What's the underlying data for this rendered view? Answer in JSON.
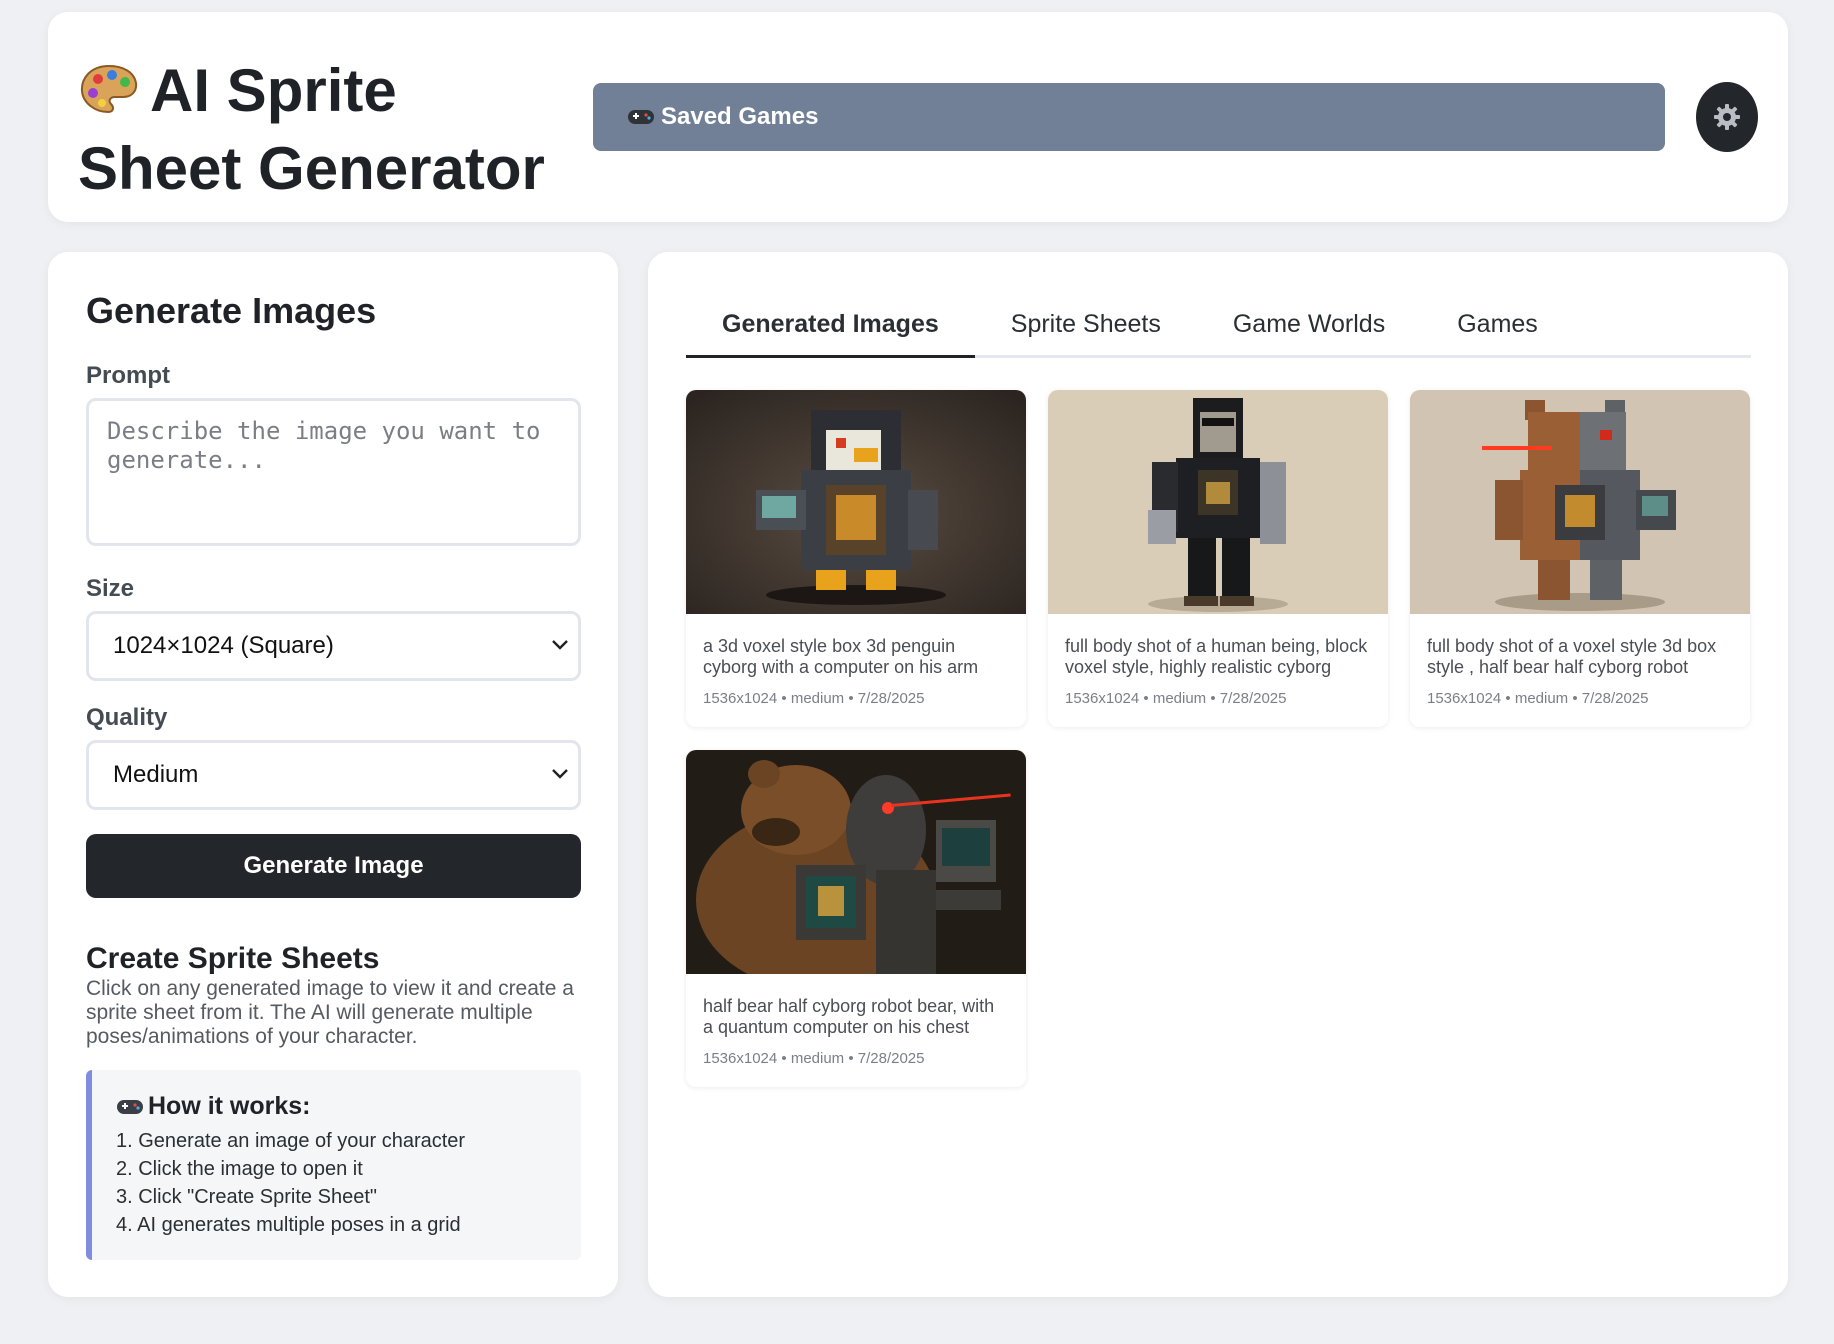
{
  "header": {
    "title": "AI Sprite Sheet Generator",
    "saved_games_label": "Saved Games",
    "palette_icon": "palette-icon",
    "settings_icon": "gear-icon"
  },
  "generate": {
    "title": "Generate Images",
    "prompt_label": "Prompt",
    "prompt_placeholder": "Describe the image you want to generate...",
    "prompt_value": "",
    "size_label": "Size",
    "size_value": "1024×1024 (Square)",
    "quality_label": "Quality",
    "quality_value": "Medium",
    "button_label": "Generate Image"
  },
  "sprite_info": {
    "title": "Create Sprite Sheets",
    "description": "Click on any generated image to view it and create a sprite sheet from it. The AI will generate multiple poses/animations of your character.",
    "how_title": "How it works:",
    "steps": [
      "1. Generate an image of your character",
      "2. Click the image to open it",
      "3. Click \"Create Sprite Sheet\"",
      "4. AI generates multiple poses in a grid"
    ]
  },
  "tabs": [
    "Generated Images",
    "Sprite Sheets",
    "Game Worlds",
    "Games"
  ],
  "active_tab": "Generated Images",
  "images": [
    {
      "caption": "a 3d voxel style box 3d penguin cyborg with a computer on his arm",
      "size": "1536x1024",
      "quality": "medium",
      "date": "7/28/2025",
      "meta": "1536x1024 • medium • 7/28/2025"
    },
    {
      "caption": "full body shot of a human being, block voxel style, highly realistic cyborg",
      "size": "1536x1024",
      "quality": "medium",
      "date": "7/28/2025",
      "meta": "1536x1024 • medium • 7/28/2025"
    },
    {
      "caption": "full body shot of a voxel style 3d box style , half bear half cyborg robot",
      "size": "1536x1024",
      "quality": "medium",
      "date": "7/28/2025",
      "meta": "1536x1024 • medium • 7/28/2025"
    },
    {
      "caption": "half bear half cyborg robot bear, with a quantum computer on his chest",
      "size": "1536x1024",
      "quality": "medium",
      "date": "7/28/2025",
      "meta": "1536x1024 • medium • 7/28/2025"
    }
  ],
  "colors": {
    "accent_dark": "#23272b",
    "saved_games_bg": "#718096",
    "how_border": "#7f8ce0"
  }
}
